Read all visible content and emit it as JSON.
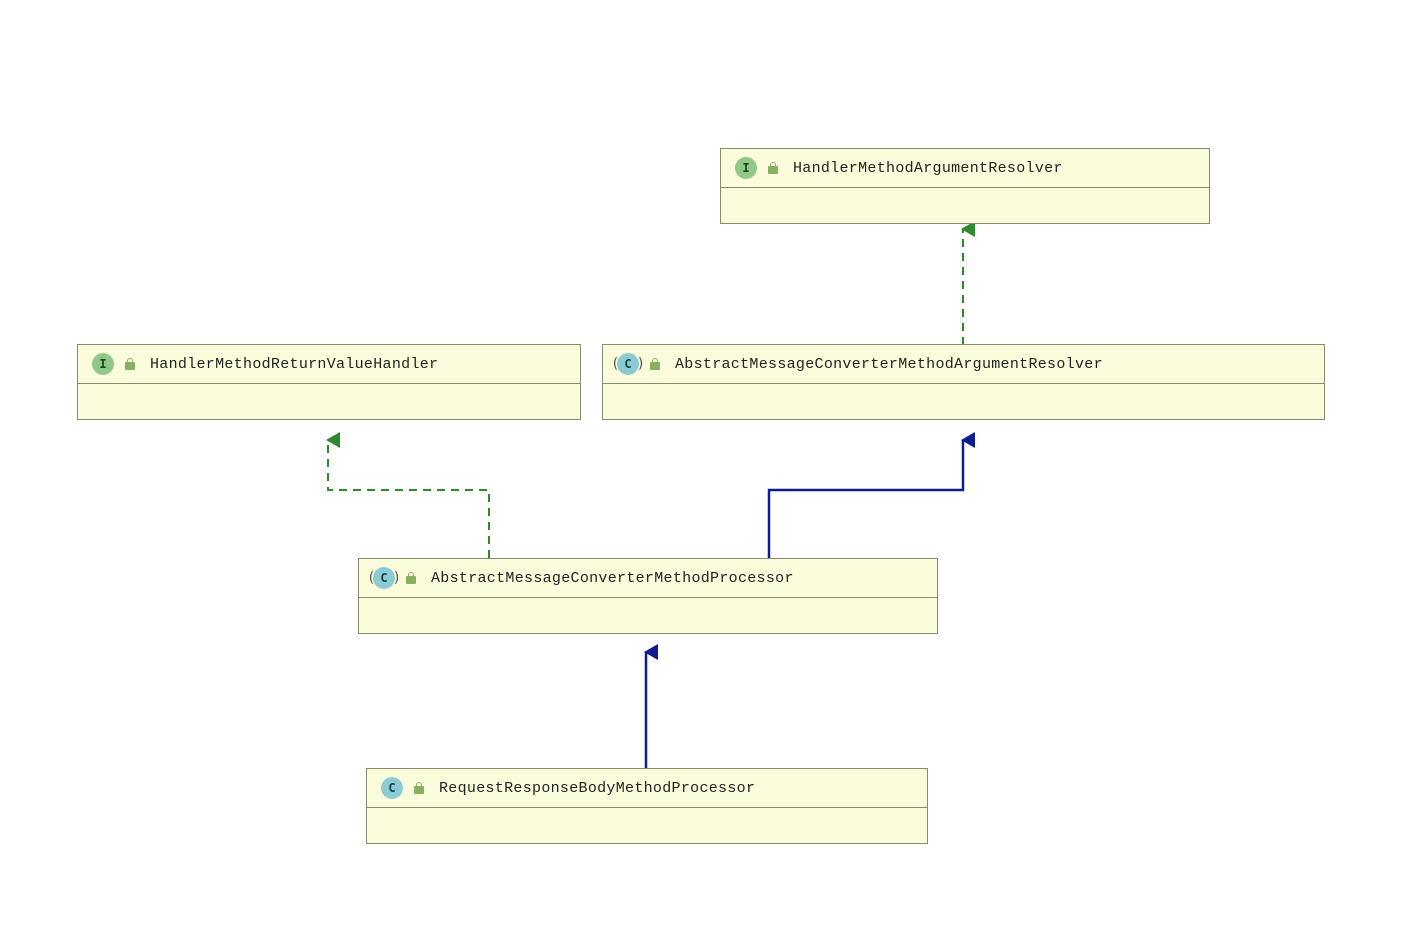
{
  "diagram": {
    "boxes": {
      "hma_resolver": {
        "type_letter": "I",
        "type_kind": "interface",
        "name": "HandlerMethodArgumentResolver"
      },
      "hmrv_handler": {
        "type_letter": "I",
        "type_kind": "interface",
        "name": "HandlerMethodReturnValueHandler"
      },
      "amcma_resolver": {
        "type_letter": "C",
        "type_kind": "abstract-class",
        "name": "AbstractMessageConverterMethodArgumentResolver"
      },
      "amcm_processor": {
        "type_letter": "C",
        "type_kind": "abstract-class",
        "name": "AbstractMessageConverterMethodProcessor"
      },
      "rrbm_processor": {
        "type_letter": "C",
        "type_kind": "class",
        "name": "RequestResponseBodyMethodProcessor"
      }
    }
  }
}
